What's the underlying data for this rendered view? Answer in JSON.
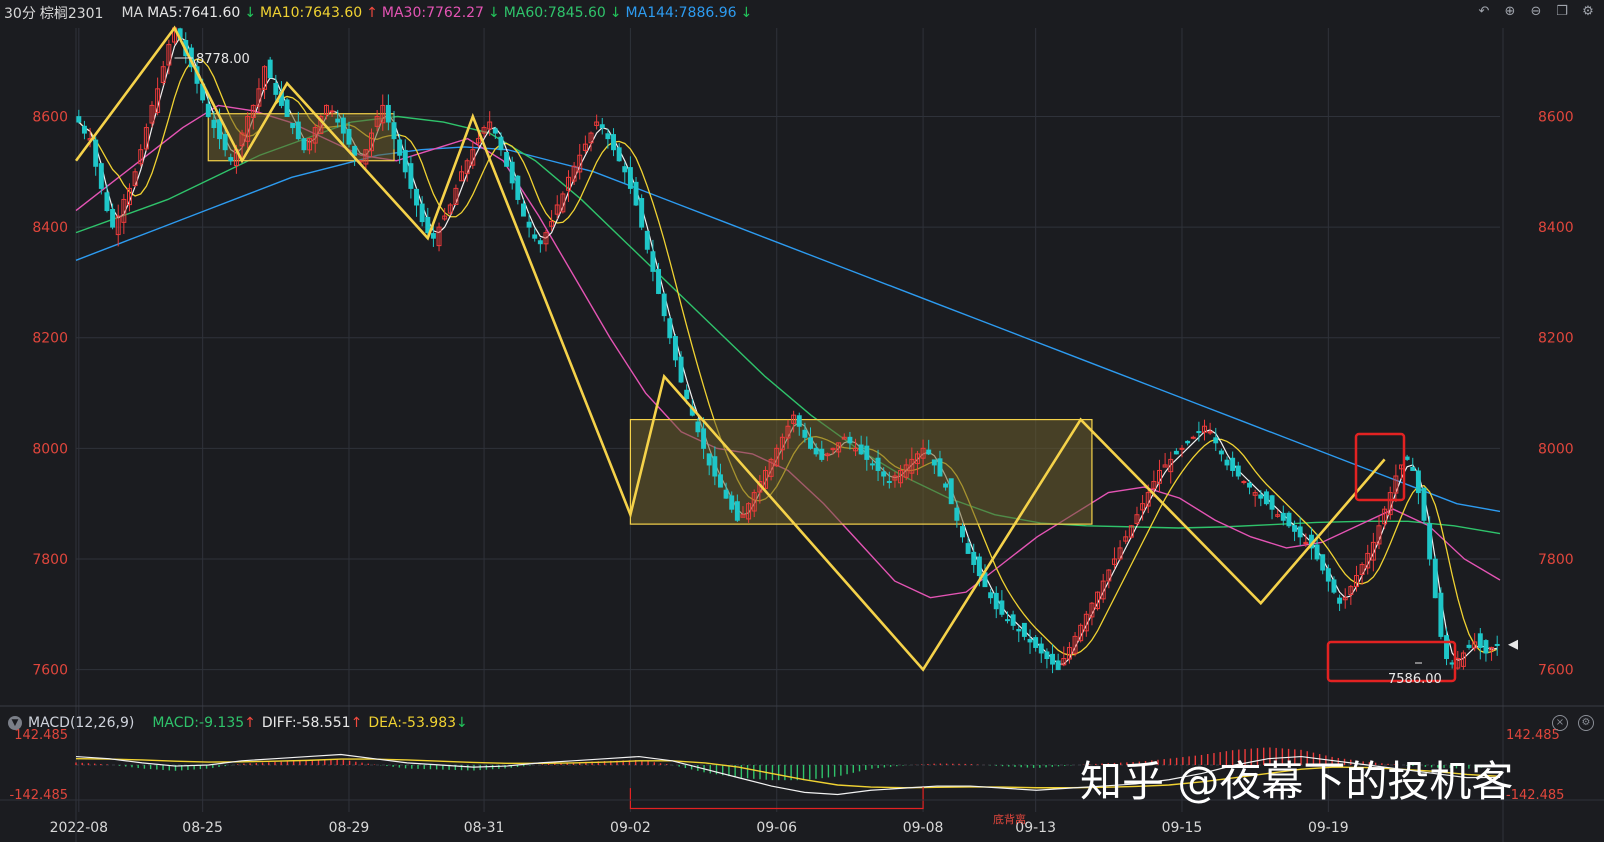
{
  "header": {
    "period": "30分",
    "symbol": "棕榈2301",
    "ma_label": "MA",
    "ma": [
      {
        "text": "MA5:7641.60",
        "dir": "↓"
      },
      {
        "text": "MA10:7643.60",
        "dir": "↑"
      },
      {
        "text": "MA30:7762.27",
        "dir": "↓"
      },
      {
        "text": "MA60:7845.60",
        "dir": "↓"
      },
      {
        "text": "MA144:7886.96",
        "dir": "↓"
      }
    ]
  },
  "toolbar_icons": [
    "undo-icon",
    "zoom-in-icon",
    "zoom-out-icon",
    "window-icon",
    "settings-icon"
  ],
  "macd_header": {
    "title": "MACD(12,26,9)",
    "macd": "MACD:-9.135",
    "macd_dir": "↑",
    "diff": "DIFF:-58.551",
    "diff_dir": "↑",
    "dea": "DEA:-53.983",
    "dea_dir": "↓"
  },
  "annotations": {
    "high_label": "8778.00",
    "low_label": "7586.00",
    "divergence_label": "底背离"
  },
  "watermark": "知乎 @夜幕下的投机客",
  "colors": {
    "background": "#1b1c20",
    "grid": "#2f323a",
    "up": "#ec3b3b",
    "down": "#1fc6c8",
    "ma5": "#f2f2f2",
    "ma10": "#f0d232",
    "ma30": "#e454b4",
    "ma60": "#2fc36b",
    "ma144": "#2d9bf0",
    "zigzag": "#f5d24a",
    "box_fill": "#6b5f2c",
    "highlight": "#e32222",
    "axis_label": "#e0463c"
  },
  "chart_data": [
    {
      "type": "candlestick",
      "y_ticks": [
        8600,
        8400,
        8200,
        8000,
        7800,
        7600
      ],
      "ylim": [
        7545,
        8760
      ],
      "x_ticks": [
        "2022-08",
        "08-25",
        "08-29",
        "08-31",
        "09-02",
        "09-06",
        "09-08",
        "09-13",
        "09-15",
        "09-19"
      ],
      "series_close_path": [
        8590,
        8570,
        8560,
        8510,
        8470,
        8430,
        8400,
        8420,
        8450,
        8470,
        8500,
        8540,
        8580,
        8620,
        8650,
        8690,
        8730,
        8760,
        8740,
        8710,
        8690,
        8660,
        8630,
        8600,
        8580,
        8560,
        8540,
        8520,
        8540,
        8570,
        8600,
        8620,
        8650,
        8690,
        8670,
        8640,
        8620,
        8600,
        8580,
        8560,
        8540,
        8560,
        8580,
        8600,
        8620,
        8610,
        8590,
        8570,
        8550,
        8530,
        8520,
        8540,
        8570,
        8600,
        8620,
        8590,
        8560,
        8530,
        8500,
        8470,
        8440,
        8410,
        8390,
        8380,
        8400,
        8420,
        8440,
        8470,
        8500,
        8520,
        8540,
        8560,
        8580,
        8590,
        8570,
        8540,
        8510,
        8480,
        8450,
        8420,
        8400,
        8380,
        8370,
        8390,
        8410,
        8440,
        8460,
        8490,
        8510,
        8530,
        8550,
        8570,
        8590,
        8580,
        8560,
        8540,
        8520,
        8500,
        8470,
        8440,
        8400,
        8360,
        8320,
        8280,
        8240,
        8200,
        8160,
        8120,
        8090,
        8060,
        8030,
        8000,
        7970,
        7950,
        7930,
        7910,
        7890,
        7870,
        7880,
        7900,
        7920,
        7940,
        7960,
        7980,
        8000,
        8020,
        8040,
        8060,
        8040,
        8020,
        8000,
        7990,
        7980,
        7990,
        8000,
        8010,
        8020,
        8010,
        8000,
        7990,
        7980,
        7970,
        7960,
        7950,
        7940,
        7950,
        7960,
        7970,
        7980,
        7990,
        8000,
        7990,
        7970,
        7950,
        7930,
        7900,
        7870,
        7840,
        7810,
        7790,
        7770,
        7750,
        7730,
        7710,
        7700,
        7690,
        7680,
        7670,
        7660,
        7650,
        7640,
        7630,
        7620,
        7610,
        7600,
        7620,
        7640,
        7660,
        7680,
        7700,
        7720,
        7740,
        7760,
        7780,
        7800,
        7820,
        7840,
        7860,
        7880,
        7900,
        7920,
        7940,
        7960,
        7970,
        7980,
        7990,
        8000,
        8010,
        8020,
        8030,
        8040,
        8030,
        8010,
        7990,
        7970,
        7960,
        7950,
        7940,
        7930,
        7920,
        7910,
        7900,
        7890,
        7880,
        7870,
        7860,
        7850,
        7840,
        7830,
        7820,
        7800,
        7780,
        7760,
        7740,
        7720,
        7730,
        7750,
        7770,
        7790,
        7810,
        7830,
        7860,
        7890,
        7920,
        7950,
        7970,
        7980,
        7960,
        7920,
        7870,
        7800,
        7730,
        7660,
        7620,
        7610,
        7620,
        7630,
        7640,
        7650,
        7640,
        7630,
        7640,
        7645
      ],
      "ma144_path": [
        8340,
        8370,
        8400,
        8430,
        8460,
        8490,
        8510,
        8530,
        8540,
        8545,
        8540,
        8520,
        8500,
        8470,
        8440,
        8410,
        8380,
        8350,
        8320,
        8290,
        8260,
        8230,
        8200,
        8170,
        8140,
        8110,
        8080,
        8050,
        8020,
        7990,
        7960,
        7930,
        7900,
        7886
      ],
      "ma60_path": [
        8390,
        8420,
        8450,
        8490,
        8530,
        8560,
        8590,
        8600,
        8590,
        8570,
        8520,
        8450,
        8370,
        8290,
        8210,
        8130,
        8060,
        8000,
        7950,
        7910,
        7880,
        7865,
        7860,
        7858,
        7856,
        7858,
        7862,
        7866,
        7868,
        7868,
        7860,
        7846
      ],
      "ma30_path": [
        8430,
        8480,
        8530,
        8580,
        8620,
        8610,
        8590,
        8560,
        8530,
        8520,
        8540,
        8560,
        8520,
        8420,
        8310,
        8200,
        8100,
        8030,
        8000,
        7990,
        7960,
        7900,
        7830,
        7760,
        7730,
        7740,
        7790,
        7840,
        7880,
        7920,
        7930,
        7910,
        7870,
        7840,
        7820,
        7830,
        7860,
        7890,
        7860,
        7800,
        7762
      ]
    },
    {
      "type": "macd",
      "ylim": [
        -142.485,
        142.485
      ],
      "y_ticks": [
        142.485,
        -142.485
      ],
      "diff_path": [
        40,
        30,
        10,
        -5,
        0,
        20,
        30,
        40,
        50,
        30,
        10,
        0,
        -10,
        -5,
        10,
        20,
        30,
        40,
        20,
        -20,
        -60,
        -100,
        -130,
        -140,
        -120,
        -110,
        -100,
        -100,
        -110,
        -120,
        -110,
        -100,
        -90,
        -70,
        -40,
        0,
        30,
        40,
        20,
        0,
        -20,
        -40,
        -60,
        -59
      ],
      "dea_path": [
        30,
        28,
        24,
        18,
        14,
        15,
        18,
        22,
        28,
        28,
        24,
        18,
        12,
        8,
        8,
        10,
        14,
        20,
        20,
        10,
        -10,
        -40,
        -70,
        -95,
        -105,
        -108,
        -106,
        -104,
        -105,
        -108,
        -108,
        -106,
        -102,
        -95,
        -80,
        -60,
        -40,
        -20,
        -10,
        -12,
        -20,
        -30,
        -45,
        -54
      ]
    }
  ]
}
